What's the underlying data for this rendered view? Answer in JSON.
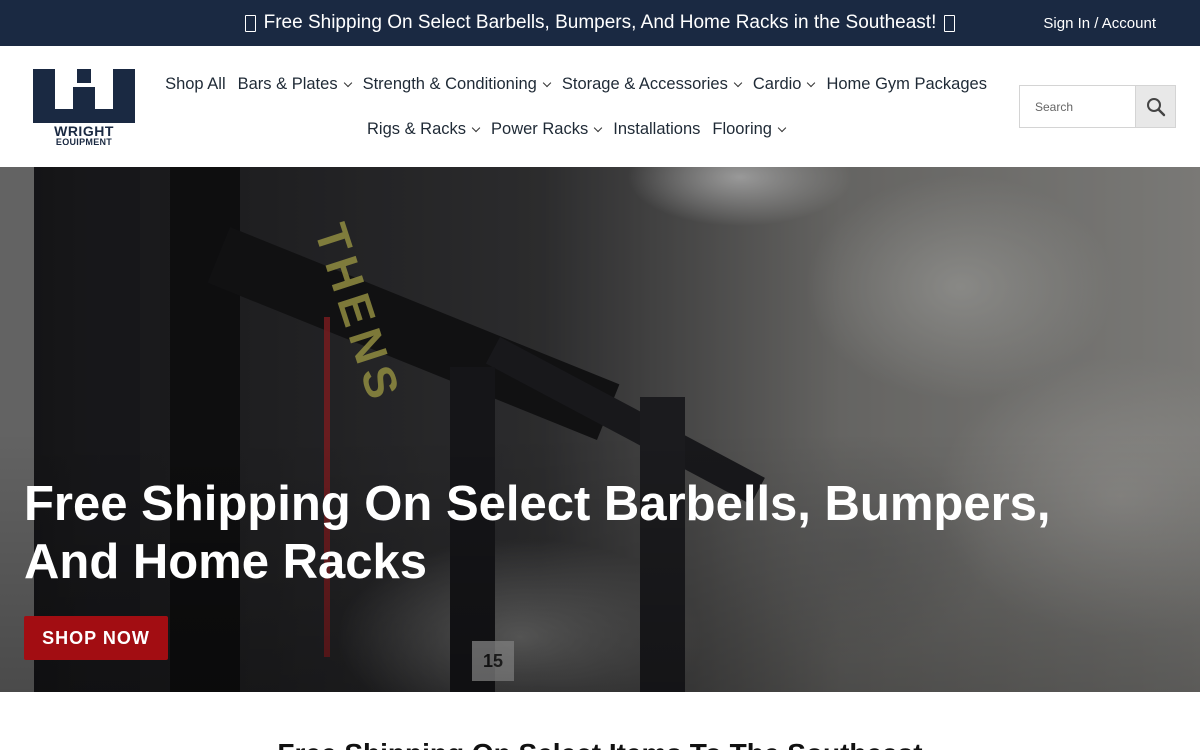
{
  "topbar": {
    "announcement": "Free Shipping On Select Barbells, Bumpers, And Home Racks in the Southeast!",
    "account_link": "Sign In / Account"
  },
  "header": {
    "logo_text": [
      "WRIGHT",
      "EQUIPMENT"
    ],
    "nav_row1": [
      {
        "label": "Shop All",
        "dropdown": false
      },
      {
        "label": "Bars & Plates",
        "dropdown": true
      },
      {
        "label": "Strength & Conditioning",
        "dropdown": true
      },
      {
        "label": "Storage & Accessories",
        "dropdown": true
      },
      {
        "label": "Cardio",
        "dropdown": true
      },
      {
        "label": "Home Gym Packages",
        "dropdown": false
      }
    ],
    "nav_row2": [
      {
        "label": "Rigs & Racks",
        "dropdown": true
      },
      {
        "label": "Power Racks",
        "dropdown": true
      },
      {
        "label": "Installations",
        "dropdown": false
      },
      {
        "label": "Flooring",
        "dropdown": true
      }
    ],
    "search": {
      "placeholder": "Search",
      "value": ""
    }
  },
  "hero": {
    "headline": "Free Shipping On Select Barbells, Bumpers, And Home Racks",
    "cta_label": "SHOP NOW",
    "image_text": {
      "rig_lettering": "THENS",
      "plate_number": "15"
    }
  },
  "section": {
    "title": "Free Shipping On Select Items To The Southeast"
  },
  "colors": {
    "topbar": "#1a2942",
    "cta": "#a20d12",
    "logo": "#1a2942"
  }
}
